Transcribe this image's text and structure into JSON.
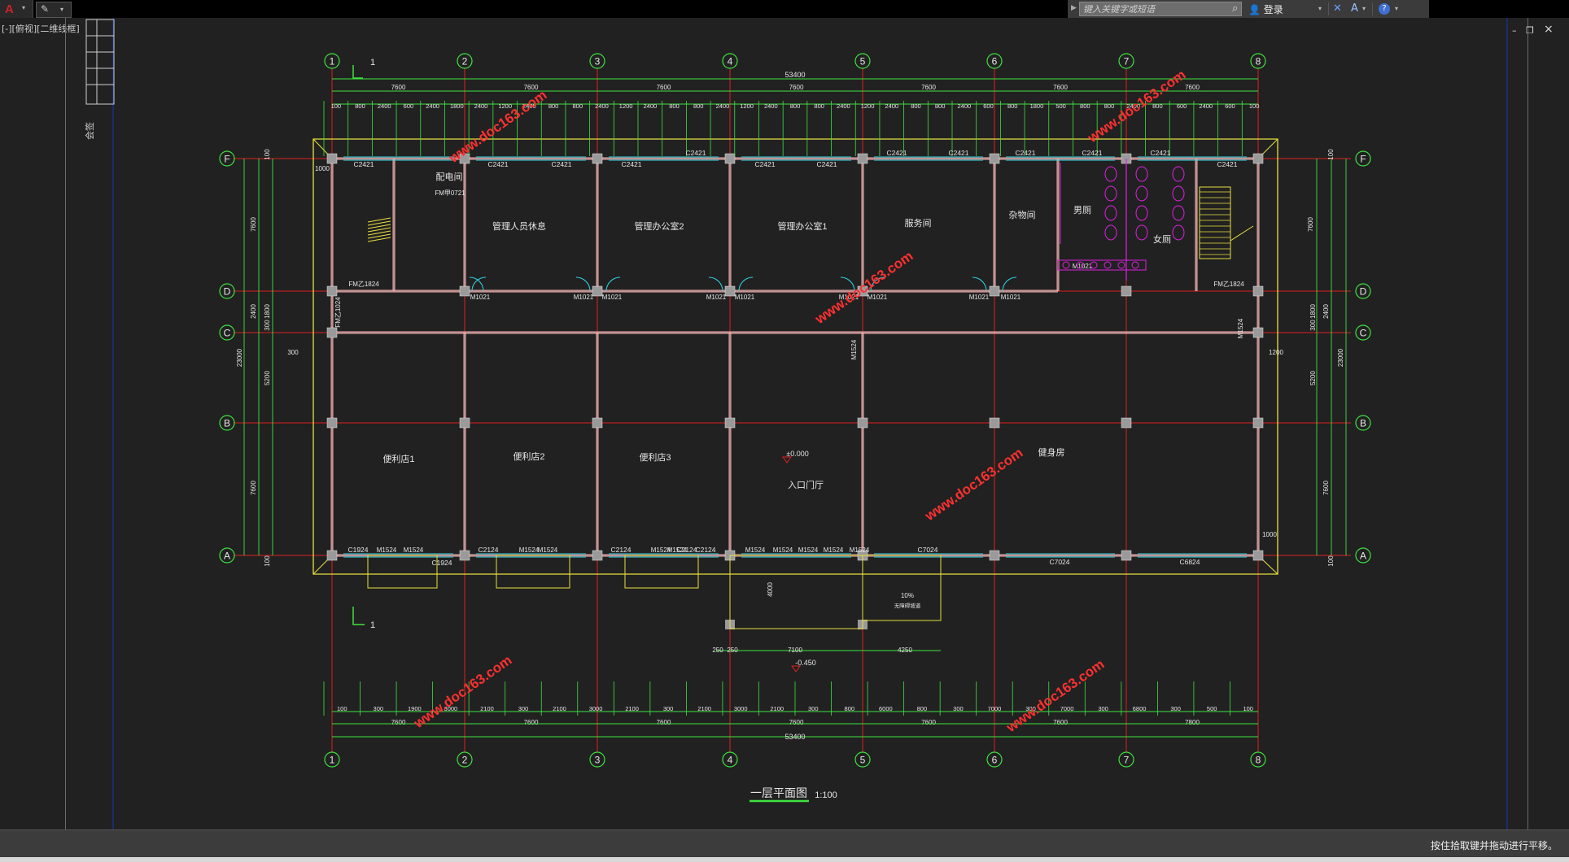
{
  "app": {
    "logo_glyph": "A",
    "caret": "▾",
    "quick_access_icon": "✎"
  },
  "search": {
    "placeholder": "键入关键字或短语",
    "login_label": "登录",
    "help": "?"
  },
  "window": {
    "minimize": "–",
    "restore": "❐",
    "close": "×"
  },
  "viewport": {
    "label": "[-][俯视][二维线框]"
  },
  "status": {
    "message": "按住拾取键并拖动进行平移。"
  },
  "watermark": "www.doc163.com",
  "drawing": {
    "title": "一层平面图",
    "scale": "1:100",
    "grid_cols": [
      "1",
      "2",
      "3",
      "4",
      "5",
      "6",
      "7",
      "8"
    ],
    "grid_rows": [
      "F",
      "D",
      "C",
      "B",
      "A"
    ],
    "total_width": "53400",
    "total_depth": "23000",
    "bay_width": "7600",
    "bay_width_bottom": [
      "7600",
      "7600",
      "7600",
      "7600",
      "7600",
      "7600",
      "7800"
    ],
    "top_detail_dims": [
      "100",
      "800",
      "2400",
      "600",
      "2400",
      "1800",
      "2400",
      "1200",
      "2400",
      "800",
      "800",
      "2400",
      "1200",
      "2400",
      "800",
      "800",
      "2400",
      "1200",
      "2400",
      "800",
      "800",
      "2400",
      "1200",
      "2400",
      "800",
      "800",
      "2400",
      "600",
      "800",
      "1800",
      "500",
      "800",
      "800",
      "2400",
      "800",
      "600",
      "2400",
      "600",
      "100"
    ],
    "bottom_detail_dims": [
      "100",
      "300",
      "1900",
      "3000",
      "2100",
      "300",
      "2100",
      "3000",
      "2100",
      "300",
      "2100",
      "3000",
      "2100",
      "300",
      "800",
      "6000",
      "800",
      "300",
      "7000",
      "300",
      "7000",
      "300",
      "6800",
      "300",
      "500",
      "100"
    ],
    "left_dims": [
      "7600",
      "2400",
      "1800",
      "300",
      "5200",
      "7600",
      "100",
      "100",
      "23000"
    ],
    "right_dims": [
      "7600",
      "2400",
      "1800",
      "300",
      "5200",
      "7600",
      "100",
      "100",
      "23000"
    ],
    "rooms": [
      "管理人员休息",
      "管理办公室2",
      "管理办公室1",
      "服务间",
      "杂物间",
      "男厕",
      "女厕",
      "配电间",
      "便利店1",
      "便利店2",
      "便利店3",
      "入口门厅",
      "健身房"
    ],
    "windows": [
      "C2421",
      "C2421",
      "C2421",
      "C2421",
      "C2421",
      "C2421",
      "C2421",
      "C2421",
      "C2421",
      "C2421",
      "C2421",
      "C2421",
      "C2421",
      "C1924",
      "C1924",
      "C2124",
      "C2124",
      "C2124",
      "C2124",
      "C7024",
      "C7024",
      "C6824"
    ],
    "doors": [
      "M1021",
      "M1021",
      "M1021",
      "M1021",
      "M1021",
      "M1021",
      "M1021",
      "M1021",
      "M1021",
      "M1021",
      "M1524",
      "M1524",
      "M1524",
      "M1524",
      "M1524",
      "M1524",
      "M1524",
      "M1524",
      "M1524",
      "M1524",
      "M1524",
      "M1524",
      "M1524",
      "FM乙1824",
      "FM乙1824",
      "FM乙1024",
      "FM甲0721"
    ],
    "levels": [
      "±0.000",
      "-0.450"
    ],
    "ramp": "10%",
    "ramp_label": "无障碍坡道",
    "section_mark": "1",
    "misc_dims": [
      "4000",
      "7100",
      "250",
      "250",
      "4250",
      "300",
      "1000",
      "1200",
      "1000"
    ]
  }
}
